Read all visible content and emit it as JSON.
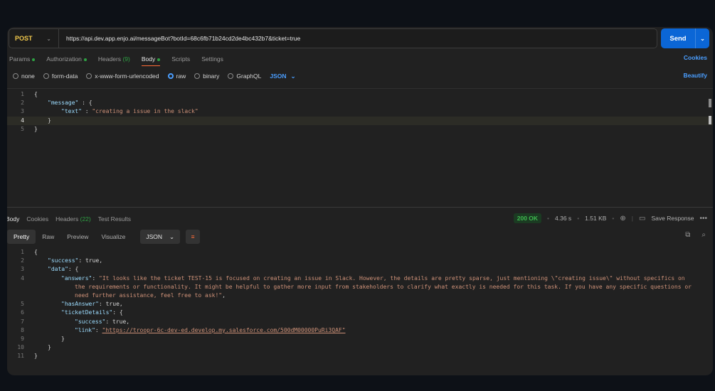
{
  "request": {
    "method": "POST",
    "url": "https://api.dev.app.enjo.ai/messageBot?botId=68c6fb71b24cd2de4bc432b7&ticket=true",
    "send_label": "Send"
  },
  "req_tabs": {
    "params": "Params",
    "authorization": "Authorization",
    "headers": "Headers",
    "headers_count": "(9)",
    "body": "Body",
    "scripts": "Scripts",
    "settings": "Settings",
    "cookies": "Cookies"
  },
  "body_types": {
    "none": "none",
    "form_data": "form-data",
    "urlencoded": "x-www-form-urlencoded",
    "raw": "raw",
    "binary": "binary",
    "graphql": "GraphQL",
    "format": "JSON",
    "beautify": "Beautify"
  },
  "request_body_lines": [
    {
      "n": "1",
      "t": "{"
    },
    {
      "n": "2",
      "k": "\"message\"",
      "t": " : {"
    },
    {
      "n": "3",
      "k": "\"text\"",
      "t": " : ",
      "s": "\"creating a issue in the slack\""
    },
    {
      "n": "4",
      "t": "}"
    },
    {
      "n": "5",
      "t": "}"
    }
  ],
  "response": {
    "tabs": {
      "body": "Body",
      "cookies": "Cookies",
      "headers": "Headers",
      "headers_count": "(22)",
      "test_results": "Test Results"
    },
    "status": "200 OK",
    "time": "4.36 s",
    "size": "1.51 KB",
    "save": "Save Response",
    "views": {
      "pretty": "Pretty",
      "raw": "Raw",
      "preview": "Preview",
      "visualize": "Visualize",
      "format": "JSON"
    },
    "lines": [
      {
        "n": "1",
        "text": "{"
      },
      {
        "n": "2",
        "key": "\"success\"",
        "rest": ": true,"
      },
      {
        "n": "3",
        "key": "\"data\"",
        "rest": ": {"
      },
      {
        "n": "4",
        "key": "\"answers\"",
        "rest": ": ",
        "str": "\"It looks like the ticket TEST-15 is focused on creating an issue in Slack. However, the details are pretty sparse, just mentioning \\\"creating issue\\\" without specifics on"
      },
      {
        "n": "",
        "str": "the requirements or functionality. It might be helpful to gather more input from stakeholders to clarify what exactly is needed for this task. If you have any specific questions or"
      },
      {
        "n": "",
        "str": "need further assistance, feel free to ask!\"",
        "rest": ","
      },
      {
        "n": "5",
        "key": "\"hasAnswer\"",
        "rest": ": true,"
      },
      {
        "n": "6",
        "key": "\"ticketDetails\"",
        "rest": ": {"
      },
      {
        "n": "7",
        "key": "\"success\"",
        "rest": ": true,"
      },
      {
        "n": "8",
        "key": "\"link\"",
        "rest": ": ",
        "link": "\"https://troopr-6c-dev-ed.develop.my.salesforce.com/500dM00000PuRi3QAF\""
      },
      {
        "n": "9",
        "text": "}"
      },
      {
        "n": "10",
        "text": "}"
      },
      {
        "n": "11",
        "text": "}"
      }
    ]
  }
}
